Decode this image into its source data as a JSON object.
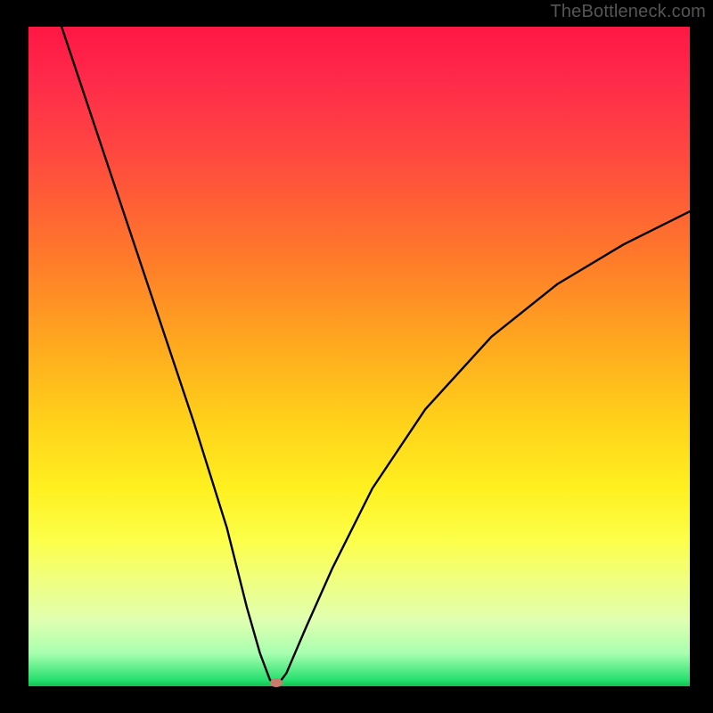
{
  "watermark": "TheBottleneck.com",
  "marker": {
    "x_pct": 37.5,
    "y_pct": 99.4
  },
  "chart_data": {
    "type": "line",
    "title": "",
    "xlabel": "",
    "ylabel": "",
    "ylim": [
      0,
      100
    ],
    "xlim": [
      0,
      100
    ],
    "series": [
      {
        "name": "bottleneck-curve",
        "x": [
          5,
          10,
          15,
          20,
          25,
          30,
          33,
          35,
          36.5,
          37.5,
          39,
          42,
          46,
          52,
          60,
          70,
          80,
          90,
          100
        ],
        "values": [
          100,
          85,
          70,
          55,
          40,
          24,
          12,
          5,
          1,
          0,
          2,
          9,
          18,
          30,
          42,
          53,
          61,
          67,
          72
        ]
      }
    ],
    "gradient_stops": [
      {
        "pos": 0,
        "color": "#ff1744"
      },
      {
        "pos": 50,
        "color": "#ffcc00"
      },
      {
        "pos": 80,
        "color": "#ffff66"
      },
      {
        "pos": 100,
        "color": "#10c050"
      }
    ],
    "marker_point": {
      "x": 37.5,
      "y": 0
    }
  }
}
